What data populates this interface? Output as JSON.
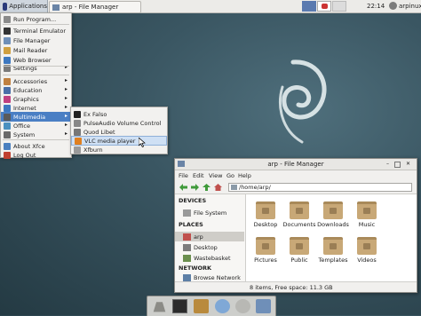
{
  "panel": {
    "applications_label": "Applications",
    "task_label": "arp - File Manager",
    "clock": "22:14",
    "user": "arpinux"
  },
  "app_menu": {
    "items": [
      {
        "label": "Run Program...",
        "icon": "run-icon",
        "submenu": false
      },
      {
        "label": "Terminal Emulator",
        "icon": "terminal-icon",
        "submenu": false
      },
      {
        "label": "File Manager",
        "icon": "folder-icon",
        "submenu": false
      },
      {
        "label": "Mail Reader",
        "icon": "mail-icon",
        "submenu": false
      },
      {
        "label": "Web Browser",
        "icon": "globe-icon",
        "submenu": false
      },
      {
        "label": "Settings",
        "icon": "settings-icon",
        "submenu": true
      },
      {
        "label": "Accessories",
        "icon": "accessories-icon",
        "submenu": true
      },
      {
        "label": "Education",
        "icon": "education-icon",
        "submenu": true
      },
      {
        "label": "Graphics",
        "icon": "graphics-icon",
        "submenu": true
      },
      {
        "label": "Internet",
        "icon": "internet-icon",
        "submenu": true
      },
      {
        "label": "Multimedia",
        "icon": "multimedia-icon",
        "submenu": true,
        "selected": true
      },
      {
        "label": "Office",
        "icon": "office-icon",
        "submenu": true
      },
      {
        "label": "System",
        "icon": "system-icon",
        "submenu": true
      },
      {
        "label": "About Xfce",
        "icon": "info-icon",
        "submenu": false
      },
      {
        "label": "Log Out",
        "icon": "logout-icon",
        "submenu": false
      }
    ]
  },
  "multimedia_menu": {
    "items": [
      {
        "label": "Ex Falso",
        "icon": "exfalso-icon"
      },
      {
        "label": "PulseAudio Volume Control",
        "icon": "volume-icon"
      },
      {
        "label": "Quod Libet",
        "icon": "quodlibet-icon"
      },
      {
        "label": "VLC media player",
        "icon": "vlc-icon",
        "hovered": true
      },
      {
        "label": "Xfburn",
        "icon": "disc-icon"
      }
    ]
  },
  "file_manager": {
    "title": "arp - File Manager",
    "menu": [
      "File",
      "Edit",
      "View",
      "Go",
      "Help"
    ],
    "location": "/home/arp/",
    "sidebar": {
      "devices_heading": "DEVICES",
      "devices": [
        {
          "label": "File System",
          "icon": "harddisk-icon"
        }
      ],
      "places_heading": "PLACES",
      "places": [
        {
          "label": "arp",
          "icon": "home-icon",
          "selected": true
        },
        {
          "label": "Desktop",
          "icon": "desktop-icon"
        },
        {
          "label": "Wastebasket",
          "icon": "trash-icon"
        }
      ],
      "network_heading": "NETWORK",
      "network": [
        {
          "label": "Browse Network",
          "icon": "network-icon"
        }
      ]
    },
    "folders": [
      "Desktop",
      "Documents",
      "Downloads",
      "Music",
      "Pictures",
      "Public",
      "Templates",
      "Videos"
    ],
    "status": "8 items, Free space: 11.3 GB"
  },
  "colors": {
    "menu_selected": "#4a7fc4",
    "folder": "#c8a877",
    "desktop_bg": "#3a5662"
  }
}
